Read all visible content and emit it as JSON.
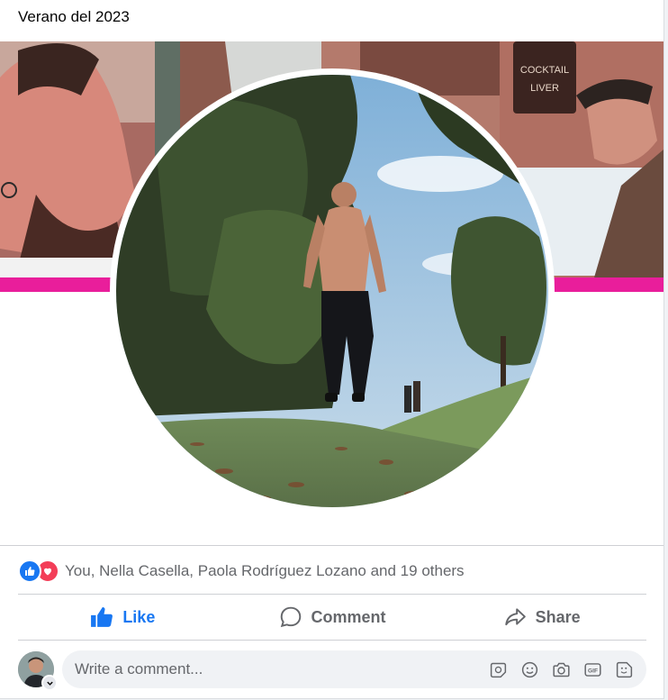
{
  "post": {
    "caption": "Verano del 2023",
    "photo_description": ""
  },
  "reactions": {
    "types": [
      "like-icon",
      "love-icon"
    ],
    "summary": "You, Nella Casella, Paola Rodríguez Lozano and 19 others"
  },
  "actions": {
    "like_label": "Like",
    "comment_label": "Comment",
    "share_label": "Share"
  },
  "comment": {
    "placeholder": "Write a comment...",
    "icons": [
      "avatar-sticker-icon",
      "emoji-icon",
      "camera-icon",
      "gif-icon",
      "sticker-icon"
    ]
  },
  "colors": {
    "accent": "#1877f2",
    "love": "#f33e58",
    "cover_band": "#e91e9b",
    "muted_text": "#65676b"
  }
}
